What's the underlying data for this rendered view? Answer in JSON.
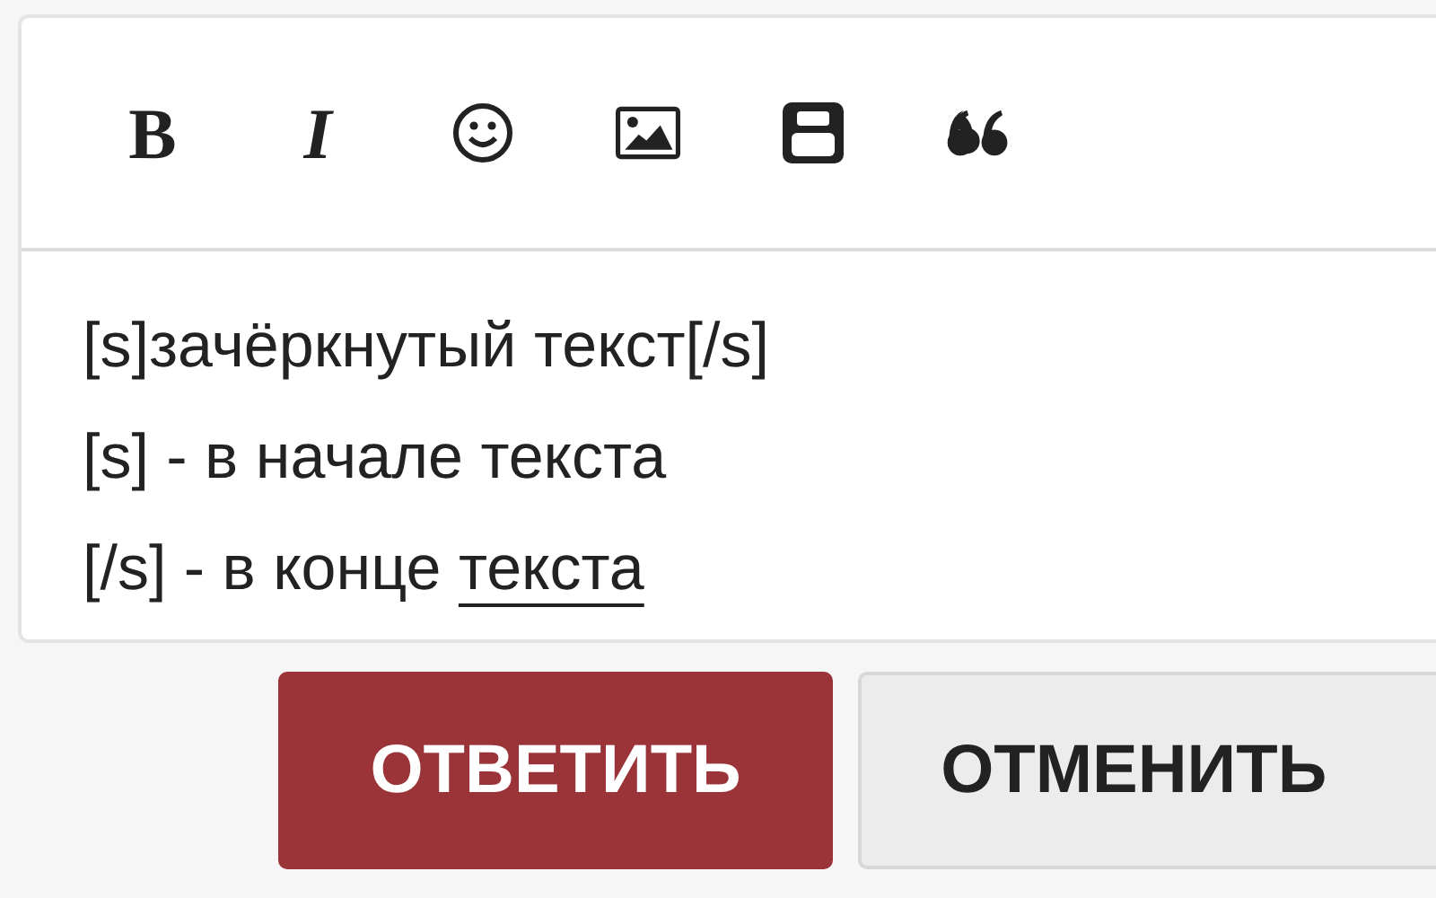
{
  "toolbar": [
    {
      "kind": "bold",
      "label": "B"
    },
    {
      "kind": "italic",
      "label": "I"
    },
    {
      "kind": "smiley"
    },
    {
      "kind": "image"
    },
    {
      "kind": "video"
    },
    {
      "kind": "quote"
    }
  ],
  "editor": {
    "lines": [
      {
        "text": "[s]зачёркнутый текст[/s]"
      },
      {
        "text": "[s] - в начале текста"
      },
      {
        "text": "[/s] - в конце ",
        "marked": "текста"
      }
    ]
  },
  "buttons": [
    {
      "label": "ОТВЕТИТЬ",
      "kind": "primary"
    },
    {
      "label": "ОТМЕНИТЬ",
      "kind": "secondary"
    }
  ]
}
